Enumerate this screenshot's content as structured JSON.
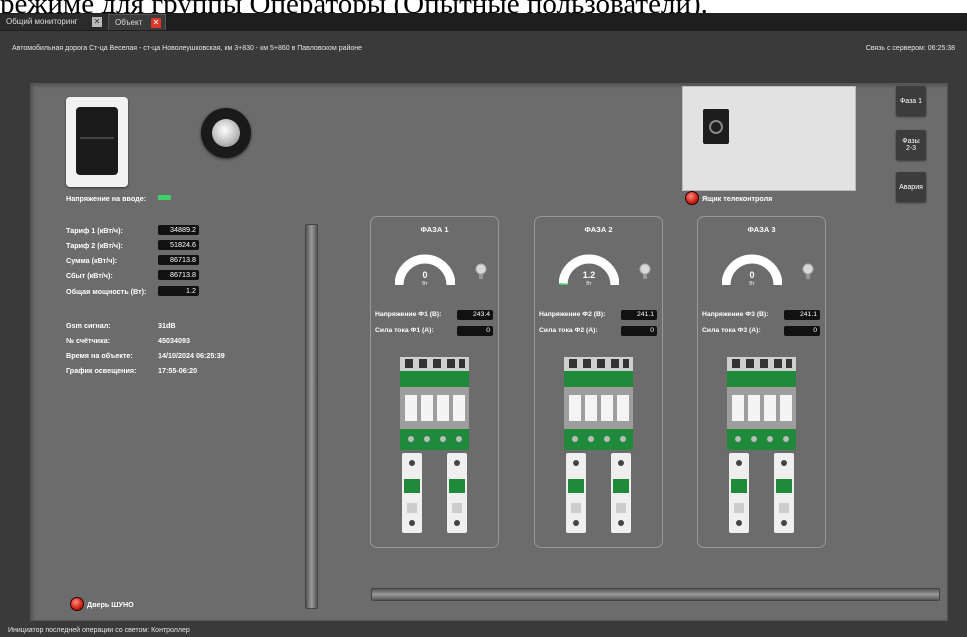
{
  "page_heading": "режиме для группы Операторы (Опытные пользователи).",
  "tabs": [
    {
      "label": "Общий мониторинг",
      "close": "✕"
    },
    {
      "label": "Объект",
      "close": "✕"
    }
  ],
  "header": {
    "object_title": "Автомобильная дорога Ст-ца Веселая - ст-ца Новолеушковская, км 3+830 - км 5+860 в Павловском районе",
    "server_link": "Связь с сервером: 06:25:38"
  },
  "input": {
    "voltage_label": "Напряжение на вводе:"
  },
  "meters": [
    {
      "label": "Тариф 1 (кВт/ч):",
      "value": "34889.2"
    },
    {
      "label": "Тариф 2 (кВт/ч):",
      "value": "51824.6"
    },
    {
      "label": "Сумма (кВт/ч):",
      "value": "86713.8"
    },
    {
      "label": "Сбыт (кВт/ч):",
      "value": "86713.8"
    },
    {
      "label": "Общая мощность (Вт):",
      "value": "1.2"
    }
  ],
  "info": [
    {
      "label": "Gsm сигнал:",
      "value": "31dB"
    },
    {
      "label": "№ счётчика:",
      "value": "45034093"
    },
    {
      "label": "Время на объекте:",
      "value": "14/10/2024 06:25:39"
    },
    {
      "label": "График освещения:",
      "value": "17:55-06:20"
    }
  ],
  "telecontrol": {
    "label": "Ящик телеконтроля"
  },
  "side_buttons": [
    "Фаза 1",
    "Фазы 2-3",
    "Авария"
  ],
  "phases": [
    {
      "title": "ФАЗА 1",
      "power": "0",
      "unit": "Вт",
      "power_fraction": 0,
      "voltage_label": "Напряжение Ф1 (В):",
      "voltage": "243.4",
      "current_label": "Сила тока Ф1 (А):",
      "current": "0"
    },
    {
      "title": "ФАЗА 2",
      "power": "1.2",
      "unit": "Вт",
      "power_fraction": 0.02,
      "voltage_label": "Напряжение Ф2 (В):",
      "voltage": "241.1",
      "current_label": "Сила тока Ф2 (А):",
      "current": "0"
    },
    {
      "title": "ФАЗА 3",
      "power": "0",
      "unit": "Вт",
      "power_fraction": 0,
      "voltage_label": "Напряжение Ф3 (В):",
      "voltage": "241.1",
      "current_label": "Сила тока Ф3 (А):",
      "current": "0"
    }
  ],
  "door": {
    "label": "Дверь ШУНО"
  },
  "footer": {
    "initiator": "Инициатор последней операции со светом: Контроллер"
  },
  "colors": {
    "panel": "#6c6c6c",
    "led_green": "#3fd06a",
    "led_red": "#d3261a",
    "contactor_green": "#1f8a3c",
    "tab_close_red": "#d9372b"
  }
}
